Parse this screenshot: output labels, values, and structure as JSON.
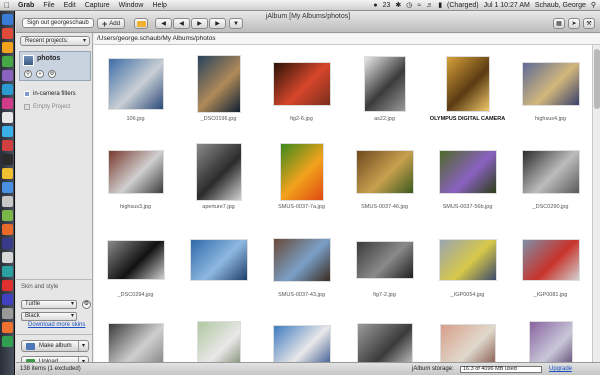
{
  "menubar": {
    "app": "Grab",
    "items": [
      "File",
      "Edit",
      "Capture",
      "Window",
      "Help"
    ],
    "status": {
      "badge": "23",
      "battery": "(Charged)",
      "datetime": "Jul 1 10:27 AM",
      "user": "Schaub, George"
    }
  },
  "window": {
    "title": "jAlbum [My Albums/photos]",
    "signout": "Sign out georgeschaub",
    "add_label": "Add"
  },
  "sidebar": {
    "recent_projects": "Recent projects:",
    "project": "photos",
    "tree": [
      {
        "label": "in-camera filters"
      },
      {
        "label": "Empty Project"
      }
    ],
    "skin_section": "Skin and style",
    "skin": "Turtle",
    "style": "Black",
    "download_skins": "Download more skins",
    "make_album": "Make album",
    "upload": "Upload"
  },
  "path": "/Users/george.schaub/My Albums/photos",
  "tiles": [
    {
      "caption": "106.jpg",
      "colors": [
        "#3e6ea8",
        "#c9cfd4",
        "#2b4a7a"
      ],
      "w": 56,
      "h": 52,
      "bold": false
    },
    {
      "caption": "_DSC0196.jpg",
      "colors": [
        "#27425e",
        "#b08a59",
        "#0f1f33"
      ],
      "w": 44,
      "h": 58,
      "bold": false
    },
    {
      "caption": "fig2-6.jpg",
      "colors": [
        "#2a1408",
        "#d7462b",
        "#7a2e1c"
      ],
      "w": 58,
      "h": 44,
      "bold": false
    },
    {
      "caption": "as22.jpg",
      "colors": [
        "#e9e9e9",
        "#3b3b3b",
        "#9a9a9a"
      ],
      "w": 42,
      "h": 56,
      "bold": false
    },
    {
      "caption": "OLYMPUS DIGITAL CAMERA",
      "colors": [
        "#d7a13a",
        "#5b3b13",
        "#f2c96b"
      ],
      "w": 44,
      "h": 56,
      "bold": true
    },
    {
      "caption": "highsus4.jpg",
      "colors": [
        "#5e6a96",
        "#d2b87d",
        "#3a3f6a"
      ],
      "w": 58,
      "h": 44,
      "bold": false
    },
    {
      "caption": "highsus3.jpg",
      "colors": [
        "#7a3a2e",
        "#cfcfcf",
        "#3b3b3b"
      ],
      "w": 56,
      "h": 44,
      "bold": false
    },
    {
      "caption": "aperture7.jpg",
      "colors": [
        "#8a8a8a",
        "#2b2b2b",
        "#d2d2d2"
      ],
      "w": 46,
      "h": 58,
      "bold": false
    },
    {
      "caption": "SMUS-0037-7a.jpg",
      "colors": [
        "#3c8a1e",
        "#f2a21c",
        "#e04a12"
      ],
      "w": 44,
      "h": 58,
      "bold": false
    },
    {
      "caption": "SMUS-0037-46.jpg",
      "colors": [
        "#6e4a1e",
        "#c8a04e",
        "#3b5a1e"
      ],
      "w": 58,
      "h": 44,
      "bold": false
    },
    {
      "caption": "SMUS-0037-56b.jpg",
      "colors": [
        "#4e6a2a",
        "#8a62c0",
        "#2e3e1a"
      ],
      "w": 58,
      "h": 44,
      "bold": false
    },
    {
      "caption": "_DSC0290.jpg",
      "colors": [
        "#2b2b2b",
        "#bdbdbd",
        "#585858"
      ],
      "w": 58,
      "h": 44,
      "bold": false
    },
    {
      "caption": "_DSC0294.jpg",
      "colors": [
        "#8a8a8a",
        "#111111",
        "#d0d0d0"
      ],
      "w": 58,
      "h": 40,
      "bold": false
    },
    {
      "caption": "",
      "colors": [
        "#2e6aaa",
        "#8fb8e0",
        "#1e3e6a"
      ],
      "w": 58,
      "h": 42,
      "bold": false
    },
    {
      "caption": "SMUS-0037-43.jpg",
      "colors": [
        "#6a4a3a",
        "#7aa0c8",
        "#3b2b20"
      ],
      "w": 58,
      "h": 44,
      "bold": false
    },
    {
      "caption": "fig7-2.jpg",
      "colors": [
        "#3b3b3b",
        "#8a8a8a",
        "#1e1e1e"
      ],
      "w": 58,
      "h": 38,
      "bold": false
    },
    {
      "caption": "_IGP0054.jpg",
      "colors": [
        "#9aa4b0",
        "#d7c84a",
        "#3b4a6a"
      ],
      "w": 58,
      "h": 42,
      "bold": false
    },
    {
      "caption": "_IGP0081.jpg",
      "colors": [
        "#7f8fa8",
        "#c8322a",
        "#d2d2d2"
      ],
      "w": 58,
      "h": 42,
      "bold": false
    },
    {
      "caption": "",
      "colors": [
        "#3b3b3b",
        "#cfcfcf",
        "#777777"
      ],
      "w": 56,
      "h": 50,
      "bold": false
    },
    {
      "caption": "",
      "colors": [
        "#b0c8a0",
        "#e8e8e8",
        "#6a7a5a"
      ],
      "w": 44,
      "h": 54,
      "bold": false
    },
    {
      "caption": "",
      "colors": [
        "#3e7ac0",
        "#e8e8e8",
        "#2a4a8a"
      ],
      "w": 58,
      "h": 46,
      "bold": false
    },
    {
      "caption": "",
      "colors": [
        "#9a9a9a",
        "#3b3b3b",
        "#d8d8d8"
      ],
      "w": 56,
      "h": 50,
      "bold": false
    },
    {
      "caption": "",
      "colors": [
        "#d8a08a",
        "#e0d8cc",
        "#7a4a3a"
      ],
      "w": 56,
      "h": 48,
      "bold": false
    },
    {
      "caption": "",
      "colors": [
        "#8a62a0",
        "#c8c8d8",
        "#4a2e5e"
      ],
      "w": 44,
      "h": 54,
      "bold": false
    }
  ],
  "status": {
    "items": "138 items (1 excluded)",
    "storage_label": "jAlbum storage:",
    "storage_value": "16.3 of 4096 MB used",
    "upgrade": "Upgrade"
  },
  "dock_colors": [
    "#3a7bd5",
    "#e04a3a",
    "#f2a21c",
    "#45a845",
    "#8a62c0",
    "#2a9ad0",
    "#d23a8a",
    "#e8e8e8",
    "#3bb0e8",
    "#d04040",
    "#2b2b2b",
    "#f0c030",
    "#4a90e2",
    "#c8c8c8",
    "#7ab648",
    "#e86a2a",
    "#3a3a8a",
    "#d8d8d8",
    "#2aa0a0",
    "#e03030",
    "#4040c0",
    "#9a9a9a",
    "#f07030",
    "#30a050"
  ]
}
